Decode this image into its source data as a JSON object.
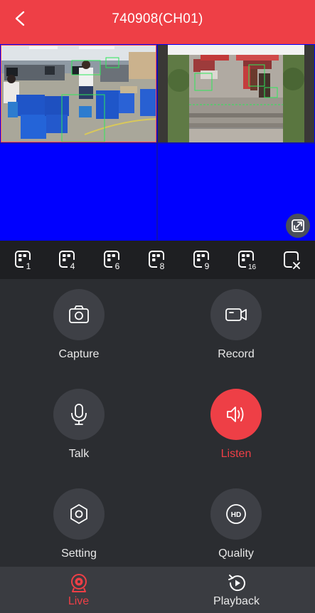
{
  "header": {
    "title": "740908(CH01)"
  },
  "colors": {
    "accent": "#ee3f46",
    "video_empty": "#0000ff",
    "panel": "#2b2d31"
  },
  "video_cells": [
    {
      "content": "camera-feed-office"
    },
    {
      "content": "camera-feed-entrance"
    },
    {
      "content": "empty"
    },
    {
      "content": "empty"
    }
  ],
  "layouts": [
    {
      "count": "1",
      "icon": "layout-1-icon"
    },
    {
      "count": "4",
      "icon": "layout-4-icon"
    },
    {
      "count": "6",
      "icon": "layout-6-icon"
    },
    {
      "count": "8",
      "icon": "layout-8-icon"
    },
    {
      "count": "9",
      "icon": "layout-9-icon"
    },
    {
      "count": "16",
      "icon": "layout-16-icon"
    },
    {
      "count": "",
      "icon": "close-all-icon"
    }
  ],
  "controls": {
    "capture": "Capture",
    "record": "Record",
    "talk": "Talk",
    "listen": "Listen",
    "setting": "Setting",
    "quality": "Quality",
    "quality_badge": "HD"
  },
  "tabs": {
    "live": "Live",
    "playback": "Playback"
  }
}
